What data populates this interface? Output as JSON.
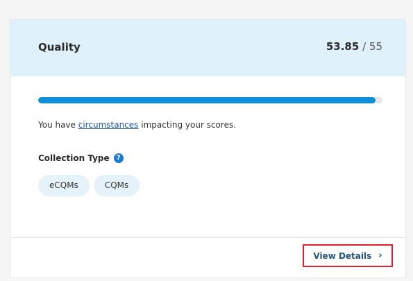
{
  "card": {
    "title": "Quality",
    "score": {
      "value": "53.85",
      "separator": "/",
      "max": "55"
    },
    "progress": {
      "fraction": 0.979,
      "color": "#0d8ed8"
    },
    "circumstances": {
      "prefix": "You have ",
      "link": "circumstances",
      "suffix": " impacting your scores."
    },
    "collection": {
      "label": "Collection Type",
      "help_icon": "help-question-icon",
      "types": [
        "eCQMs",
        "CQMs"
      ]
    },
    "footer": {
      "view_details_label": "View Details",
      "chevron_icon": "chevron-right-icon"
    }
  }
}
